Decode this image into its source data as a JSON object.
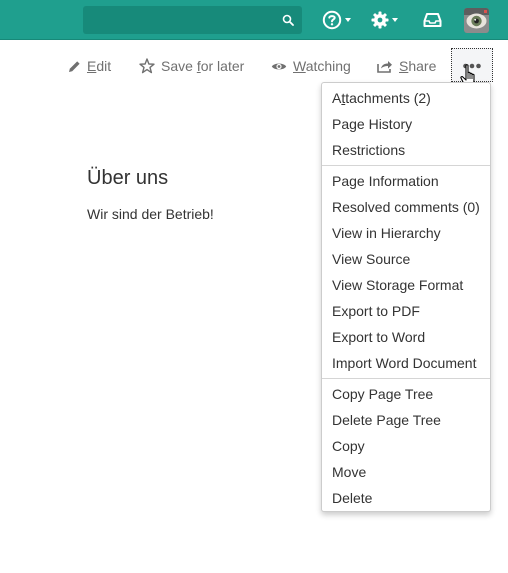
{
  "header": {
    "search": {
      "value": "",
      "placeholder": ""
    },
    "help_icon": "question-circle-icon",
    "settings_icon": "gear-icon",
    "notifications_icon": "inbox-tray-icon",
    "avatar_icon": "user-avatar",
    "brand_color": "#1f9f8e"
  },
  "toolbar": {
    "edit": {
      "pre": "",
      "ul": "E",
      "post": "dit"
    },
    "save_for_later": {
      "pre": "Save ",
      "ul": "f",
      "post": "or later"
    },
    "watching": {
      "pre": "",
      "ul": "W",
      "post": "atching"
    },
    "share": {
      "pre": "",
      "ul": "S",
      "post": "hare"
    },
    "more_icon": "ellipsis-icon"
  },
  "page": {
    "title": "Über uns",
    "body": "Wir sind der Betrieb!"
  },
  "menu": {
    "group1": [
      {
        "pre": "A",
        "ul": "t",
        "post": "tachments (2)"
      },
      {
        "pre": "Page History",
        "ul": "",
        "post": ""
      },
      {
        "pre": "Restrictions",
        "ul": "",
        "post": ""
      }
    ],
    "group2": [
      "Page Information",
      "Resolved comments (0)",
      "View in Hierarchy",
      "View Source",
      "View Storage Format",
      "Export to PDF",
      "Export to Word",
      "Import Word Document"
    ],
    "group3": [
      "Copy Page Tree",
      "Delete Page Tree",
      "Copy",
      "Move",
      "Delete"
    ]
  }
}
